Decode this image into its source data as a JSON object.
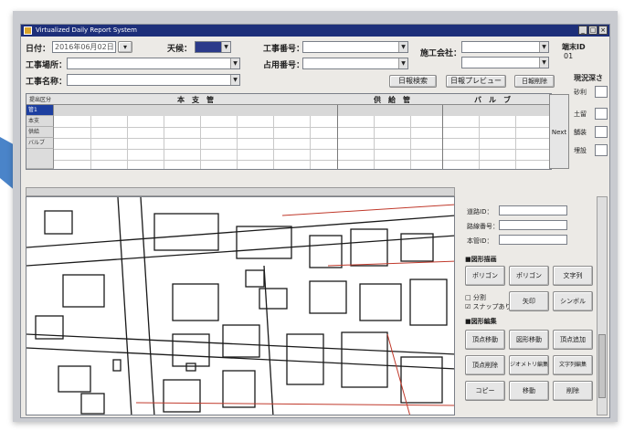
{
  "window": {
    "title": "Virtualized Daily Report System",
    "controls": [
      "_",
      "□",
      "×"
    ]
  },
  "header": {
    "date_label": "日付：",
    "date_value": "2016年06月02日",
    "date_picker": "▾",
    "weather_label": "天候：",
    "koji_no_label": "工事番号：",
    "senkosha_label": "施工会社：",
    "koji_place_label": "工事場所：",
    "dai_no_label": "占用番号：",
    "koji_name_label": "工事名称：",
    "tanmatsu_label": "端末ID",
    "tanmatsu_value": "01",
    "btn_search": "日報検索",
    "btn_preview": "日報プレビュー",
    "btn_delete": "日報削除",
    "side_label": "現況深さ",
    "side_items": [
      "砂利",
      "土留",
      "舗装",
      "埋設"
    ]
  },
  "grid": {
    "row_header_label": "提出区分",
    "col_main": "本　支　管",
    "col_supply": "供　給　管",
    "col_valve": "バ　ル　ブ",
    "rows": [
      "管1",
      "本支",
      "供給",
      "バルブ"
    ],
    "next_label": "Next"
  },
  "panel": {
    "fields": [
      "道路ID：",
      "路線番号：",
      "本管ID："
    ],
    "section1": "■図形描画",
    "btn_row1": [
      "ポリゴン",
      "ポリゴン",
      "文字列"
    ],
    "check1": "□ 分割",
    "check2": "☑ スナップあり",
    "btn_row2": [
      "矢印",
      "シンボル"
    ],
    "section2": "■図形編集",
    "btn_row3": [
      "頂点移動",
      "図形移動",
      "頂点追加"
    ],
    "btn_row4": [
      "頂点削除",
      "ジオメトリ編集",
      "文字列編集"
    ],
    "btn_row5": [
      "コピー",
      "移動",
      "削除"
    ]
  },
  "colors": {
    "titlebar": "#1d2f7a",
    "selection": "#1d3fa0",
    "weather_fill": "#2b3a8a",
    "arrow": "#2a6fc0",
    "map_line": "#1a1a1a",
    "map_red": "#c0392b"
  }
}
